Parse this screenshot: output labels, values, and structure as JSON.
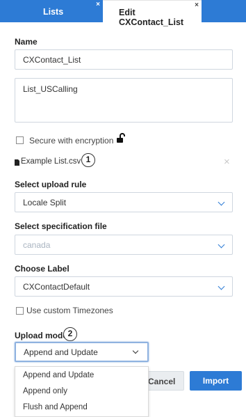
{
  "tabs": [
    {
      "label": "Lists",
      "close": "×"
    },
    {
      "label": "Edit CXContact_List",
      "close": "×"
    }
  ],
  "form": {
    "name_label": "Name",
    "name_value": "CXContact_List",
    "description_value": "List_USCalling",
    "secure_label": "Secure with encryption",
    "file_name": "Example List.csv",
    "file_remove": "×",
    "step1": "1",
    "upload_rule_label": "Select upload rule",
    "upload_rule_value": "Locale Split",
    "spec_file_label": "Select specification file",
    "spec_file_value": "canada",
    "choose_label_label": "Choose Label",
    "choose_label_value": "CXContactDefault",
    "custom_tz_label": "Use custom Timezones",
    "upload_mode_label": "Upload mode:",
    "step2": "2",
    "upload_mode_value": "Append and Update",
    "upload_mode_options": [
      "Append and Update",
      "Append only",
      "Flush and Append"
    ]
  },
  "buttons": {
    "cancel": "Cancel",
    "import": "Import"
  },
  "colors": {
    "accent": "#2d7bd5"
  }
}
